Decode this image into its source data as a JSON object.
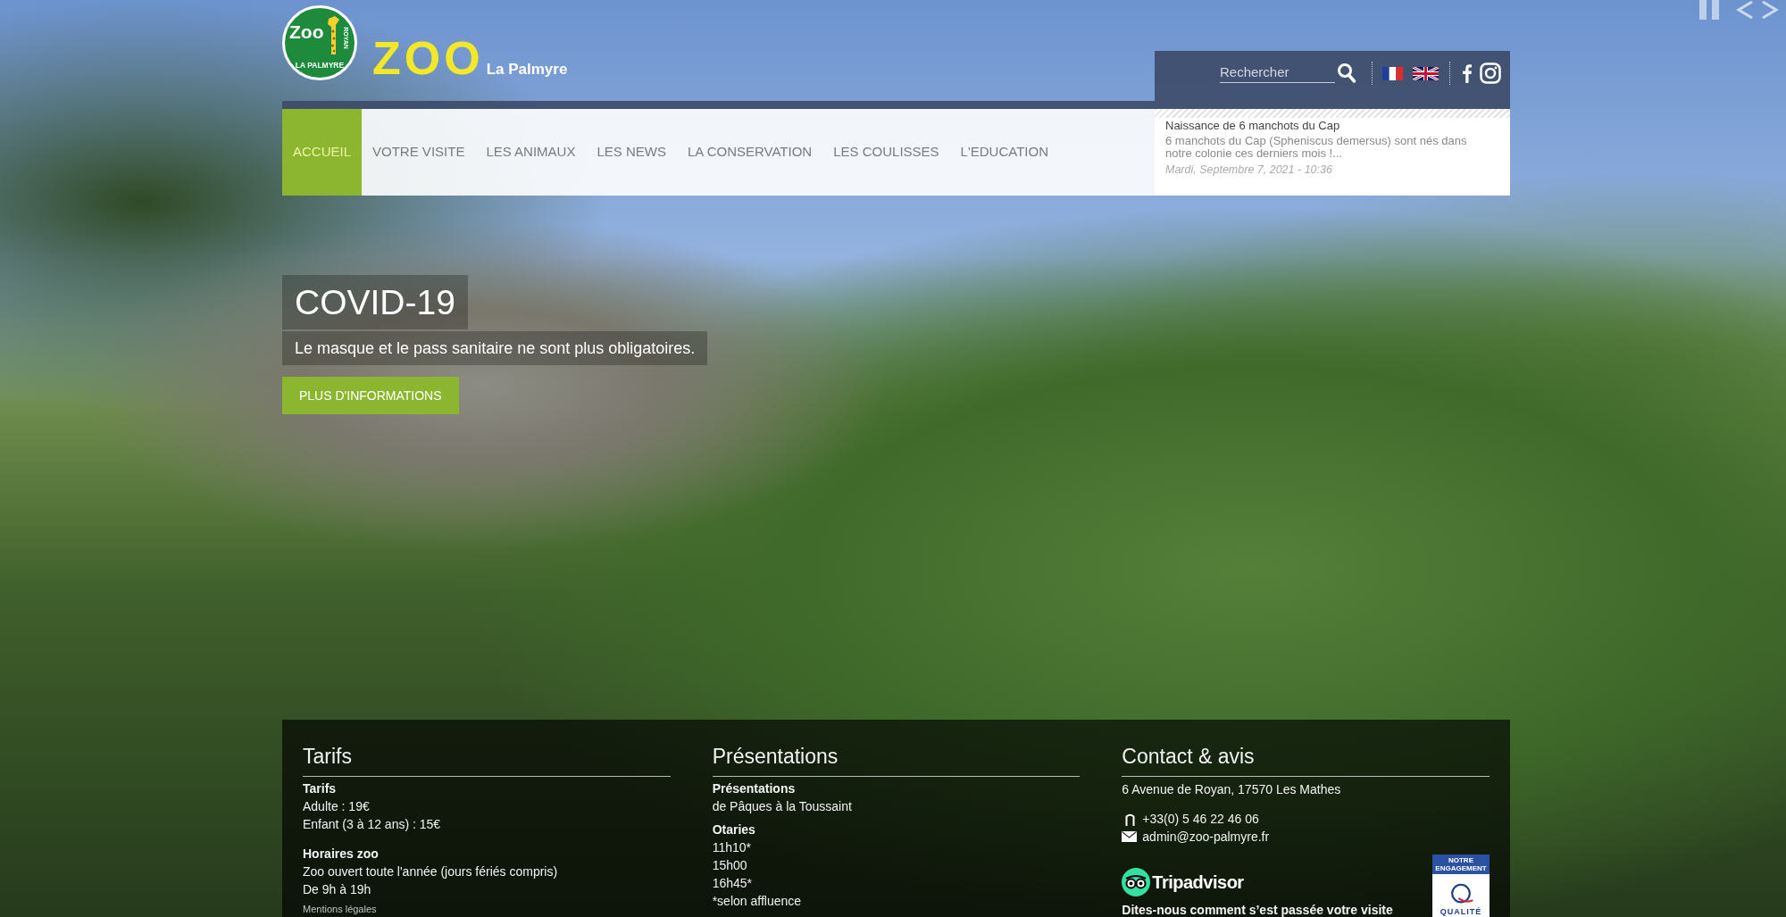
{
  "logo": {
    "badge_top": "Zoo",
    "badge_bottom": "LA PALMYRE",
    "badge_side": "ROYAN",
    "wordmark": "ZOO",
    "tagline": "La Palmyre"
  },
  "search": {
    "placeholder": "Rechercher"
  },
  "nav": {
    "items": [
      {
        "label": "ACCUEIL",
        "selected": true
      },
      {
        "label": "VOTRE VISITE",
        "selected": false
      },
      {
        "label": "LES ANIMAUX",
        "selected": false
      },
      {
        "label": "LES NEWS",
        "selected": false
      },
      {
        "label": "LA CONSERVATION",
        "selected": false
      },
      {
        "label": "LES COULISSES",
        "selected": false
      },
      {
        "label": "L'EDUCATION",
        "selected": false
      }
    ]
  },
  "news": {
    "title": "Naissance de 6 manchots du Cap",
    "summary": "6 manchots du Cap (Spheniscus demersus) sont nés dans notre colonie ces derniers mois !...",
    "date": "Mardi, Septembre 7, 2021 - 10:36"
  },
  "hero": {
    "title": "COVID-19",
    "text": "Le masque et le pass sanitaire ne sont plus obligatoires.",
    "button": "PLUS D'INFORMATIONS"
  },
  "footer": {
    "tarifs": {
      "heading": "Tarifs",
      "groups": [
        {
          "title": "Tarifs",
          "lines": [
            "Adulte : 19€",
            "Enfant (3 à 12 ans) : 15€"
          ]
        },
        {
          "title": "Horaires zoo",
          "lines": [
            "Zoo ouvert toute l'année (jours fériés compris)",
            "De 9h à 19h"
          ]
        }
      ],
      "legal_link": "Mentions légales"
    },
    "presentations": {
      "heading": "Présentations",
      "groups": [
        {
          "title": "Présentations",
          "lines": [
            "de Pâques à la Toussaint"
          ]
        },
        {
          "title": "Otaries",
          "lines": [
            "11h10*",
            "15h00",
            "16h45*",
            "*selon affluence"
          ]
        }
      ]
    },
    "contact": {
      "heading": "Contact & avis",
      "address": "6 Avenue de Royan, 17570 Les Mathes",
      "phone": "+33(0) 5 46 22 46 06",
      "email": "admin@zoo-palmyre.fr",
      "review_brand": "Tripadvisor",
      "review_prompt": "Dites-nous comment s’est passée votre visite",
      "badge_top": "NOTRE ENGAGEMENT",
      "badge_bottom": "QUALITÉ"
    }
  }
}
